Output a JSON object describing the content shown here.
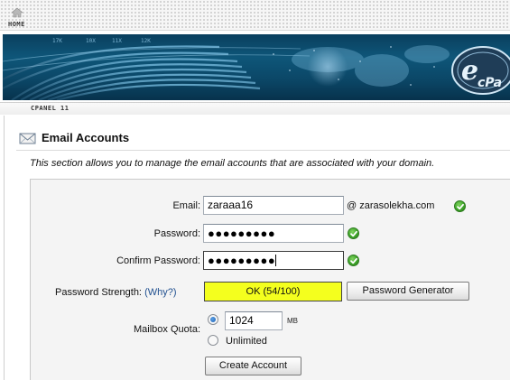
{
  "nav": {
    "home_label": "HOME",
    "section_label": "CPANEL 11"
  },
  "banner": {
    "brand_text": "cPanel",
    "numbers": [
      "17K",
      "10X",
      "11X",
      "12K"
    ],
    "accent_color": "#0e5679"
  },
  "page": {
    "title": "Email Accounts",
    "description": "This section allows you to manage the email accounts that are associated with your domain."
  },
  "form": {
    "email_label": "Email:",
    "email_value": "zaraaa16",
    "domain": "@ zarasolekha.com",
    "password_label": "Password:",
    "password_value": "●●●●●●●●●",
    "confirm_label": "Confirm Password:",
    "confirm_value": "●●●●●●●●●",
    "strength_label": "Password Strength:",
    "strength_why": "(Why?)",
    "strength_text": "OK (54/100)",
    "strength_value": 54,
    "strength_color": "#f4ff1e",
    "generator_button": "Password Generator",
    "quota_label": "Mailbox Quota:",
    "quota_value": "1024",
    "quota_unit": "MB",
    "quota_selected": "limited",
    "unlimited_label": "Unlimited",
    "create_button": "Create Account"
  },
  "icons": {
    "home": "home-icon",
    "envelope": "envelope-icon",
    "valid": "check-icon"
  }
}
